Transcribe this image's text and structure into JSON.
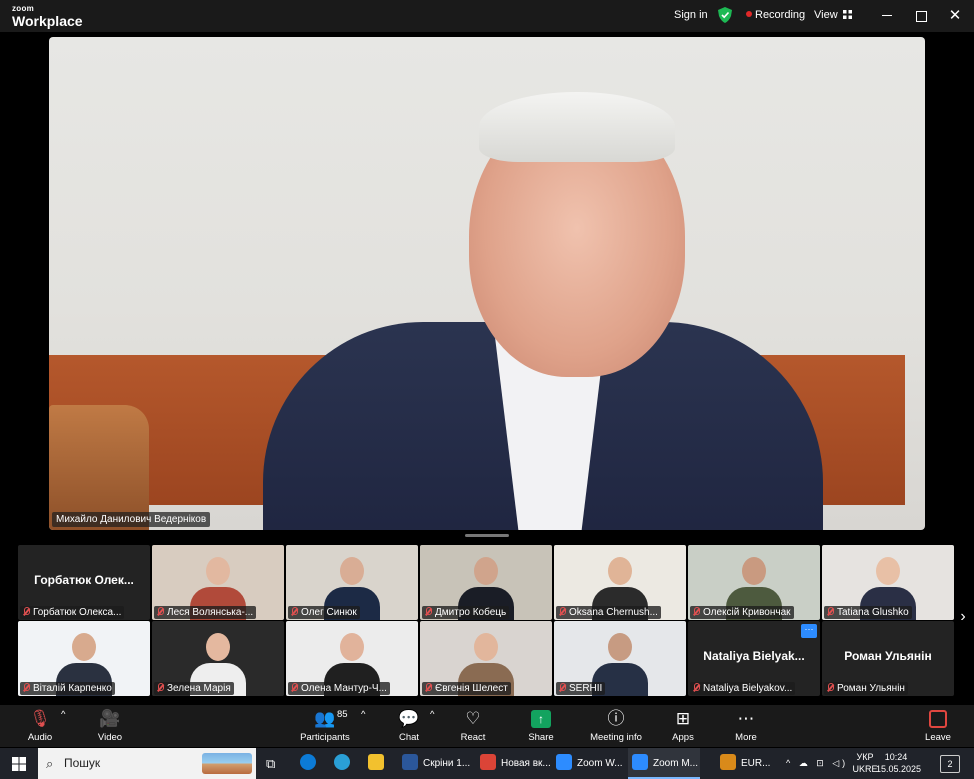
{
  "titlebar": {
    "brand_top": "zoom",
    "brand_bottom": "Workplace",
    "sign_in": "Sign in",
    "recording": "Recording",
    "view": "View",
    "icons": {
      "shield": "shield-check-icon",
      "grid": "grid-view-icon",
      "minimize": "minimize-icon",
      "maximize": "restore-icon",
      "close": "close-icon"
    },
    "close_glyph": "✕"
  },
  "active_speaker": {
    "name": "Михайло Данилович Ведерніков"
  },
  "gallery": {
    "tiles": [
      {
        "label": "Горбатюк Олекса...",
        "big_name": "Горбатюк Олек...",
        "video": false
      },
      {
        "label": "Леся Волянська-...",
        "video": true,
        "bg": "#d8ccc0",
        "skin": "#e2b8a0",
        "cloth": "#b14a3a"
      },
      {
        "label": "Олег Синюк",
        "video": true,
        "bg": "#d9d4cc",
        "skin": "#d9ad95",
        "cloth": "#1c2a45"
      },
      {
        "label": "Дмитро Кобець",
        "video": true,
        "bg": "#c8c3b8",
        "skin": "#d0a48c",
        "cloth": "#1a1d26"
      },
      {
        "label": "Oksana Chernush...",
        "video": true,
        "bg": "#ece9e2",
        "skin": "#e0b497",
        "cloth": "#2b2b2b"
      },
      {
        "label": "Олексій Кривончак",
        "video": true,
        "bg": "#c9cfc6",
        "skin": "#c99a80",
        "cloth": "#4d5a3e"
      },
      {
        "label": "Tatiana Glushko",
        "video": true,
        "bg": "#e6e3e0",
        "skin": "#e8c0a6",
        "cloth": "#2a2f45"
      },
      {
        "label": "Віталій Карпенко",
        "video": true,
        "bg": "#f1f3f6",
        "skin": "#d8aa8e",
        "cloth": "#2a3140"
      },
      {
        "label": "Зелена Марія",
        "video": true,
        "bg": "#2a2a2a",
        "skin": "#e4b89f",
        "cloth": "#eeeeee"
      },
      {
        "label": "Олена Мантур-Ч...",
        "video": true,
        "bg": "#ececec",
        "skin": "#e1b39b",
        "cloth": "#202020"
      },
      {
        "label": "Євгенія Шелест",
        "video": true,
        "bg": "#d9d4d0",
        "skin": "#e2b69c",
        "cloth": "#8a6b52"
      },
      {
        "label": "SERHII",
        "video": true,
        "bg": "#e5e7ea",
        "skin": "#c79b82",
        "cloth": "#263045"
      },
      {
        "label": "Nataliya Bielyakov...",
        "big_name": "Nataliya Bielyak...",
        "video": false,
        "badge": "···"
      },
      {
        "label": "Роман Ульянін",
        "big_name": "Роман Ульянін",
        "video": false
      }
    ],
    "next_glyph": "›"
  },
  "toolbar": {
    "audio": "Audio",
    "video": "Video",
    "participants": "Participants",
    "participants_count": "85",
    "chat": "Chat",
    "react": "React",
    "share": "Share",
    "meeting_info": "Meeting info",
    "apps": "Apps",
    "more": "More",
    "leave": "Leave",
    "caret": "^",
    "glyphs": {
      "audio": "🎙",
      "video": "🎥",
      "participants": "👥",
      "chat": "💬",
      "react": "♡",
      "share": "↑",
      "info": "ⓘ",
      "apps": "⊞",
      "more": "⋯"
    }
  },
  "taskbar": {
    "search_placeholder": "Пошук",
    "search_glyph": "⌕",
    "apps": [
      {
        "label": "Скріни 1...",
        "color": "#2b579a",
        "active": false
      },
      {
        "label": "Новая вк...",
        "color": "#db4437",
        "active": false
      },
      {
        "label": "Zoom W...",
        "color": "#2d8cff",
        "active": false
      },
      {
        "label": "Zoom M...",
        "color": "#2d8cff",
        "active": true
      },
      {
        "label": "EUR...",
        "color": "#d98a1a",
        "active": false
      }
    ],
    "language": "УКР",
    "layout": "UKRE",
    "time": "10:24",
    "date": "15.05.2025",
    "notifications": "2",
    "tray_glyphs": "^ ☁ ⊡ ◁)"
  }
}
